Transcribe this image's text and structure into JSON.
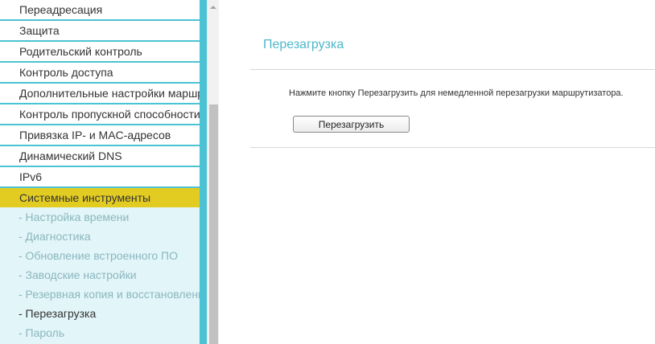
{
  "sidebar": {
    "items": [
      {
        "label": "Переадресация"
      },
      {
        "label": "Защита"
      },
      {
        "label": "Родительский контроль"
      },
      {
        "label": "Контроль доступа"
      },
      {
        "label": "Дополнительные настройки маршрутизации"
      },
      {
        "label": "Контроль пропускной способности"
      },
      {
        "label": "Привязка IP- и MAC-адресов"
      },
      {
        "label": "Динамический DNS"
      },
      {
        "label": "IPv6"
      },
      {
        "label": "Системные инструменты"
      }
    ],
    "subitems": [
      {
        "label": "- Настройка времени"
      },
      {
        "label": "- Диагностика"
      },
      {
        "label": "- Обновление встроенного ПО"
      },
      {
        "label": "- Заводские настройки"
      },
      {
        "label": "- Резервная копия и восстановление"
      },
      {
        "label": "- Перезагрузка"
      },
      {
        "label": "- Пароль"
      }
    ]
  },
  "main": {
    "title": "Перезагрузка",
    "instruction": "Нажмите кнопку Перезагрузить для немедленной перезагрузки маршрутизатора.",
    "button_label": "Перезагрузить"
  },
  "colors": {
    "accent": "#4cc3d4",
    "active_menu": "#e3cc22",
    "submenu_bg": "#e2f5f8",
    "title": "#4cb8c9"
  }
}
